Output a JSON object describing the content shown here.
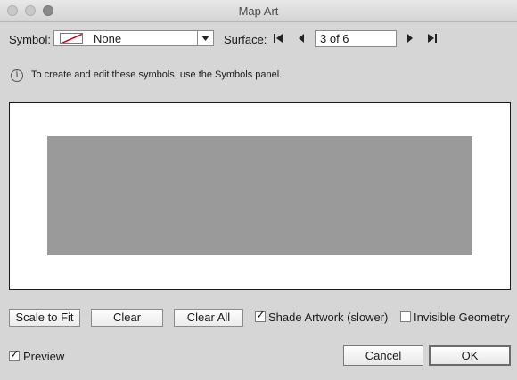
{
  "window": {
    "title": "Map Art"
  },
  "symbol": {
    "label": "Symbol:",
    "selected": "None",
    "swatch_icon": "none-swatch-icon"
  },
  "surface": {
    "label": "Surface:",
    "value": "3 of 6",
    "first_icon": "first-icon",
    "prev_icon": "previous-icon",
    "next_icon": "next-icon",
    "last_icon": "last-icon"
  },
  "info": {
    "icon": "info-icon",
    "glyph": "i",
    "text": "To create and edit these symbols, use the Symbols panel."
  },
  "preview": {
    "surface_color": "#9a9a9a",
    "background_color": "#ffffff"
  },
  "actions": {
    "scale_to_fit": "Scale to Fit",
    "clear": "Clear",
    "clear_all": "Clear All",
    "shade_artwork": {
      "label": "Shade Artwork (slower)",
      "checked": true
    },
    "invisible_geometry": {
      "label": "Invisible Geometry",
      "checked": false
    }
  },
  "footer": {
    "preview": {
      "label": "Preview",
      "checked": true
    },
    "cancel": "Cancel",
    "ok": "OK"
  },
  "check_glyph": "✓"
}
